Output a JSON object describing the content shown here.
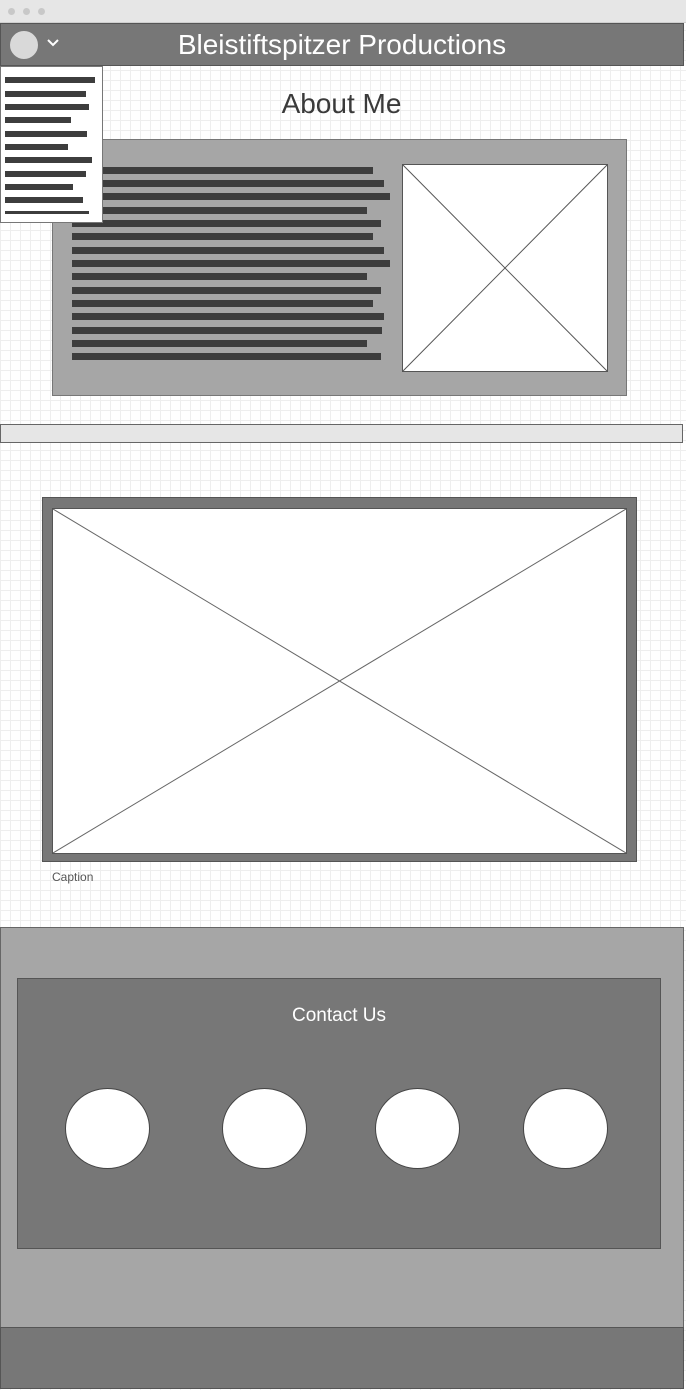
{
  "header": {
    "title": "Bleistiftspitzer Productions"
  },
  "about": {
    "title": "About Me"
  },
  "gallery": {
    "caption": "Caption"
  },
  "contact": {
    "title": "Contact Us"
  },
  "icons": {
    "avatar": "avatar-icon",
    "menu_toggle": "chevron-down-icon",
    "image_placeholder": "image-placeholder-icon",
    "contact_link": "circle-icon"
  },
  "colors": {
    "header_bg": "#777777",
    "panel_bg": "#a6a6a6",
    "text_dark": "#3d3d3d",
    "white": "#ffffff"
  }
}
